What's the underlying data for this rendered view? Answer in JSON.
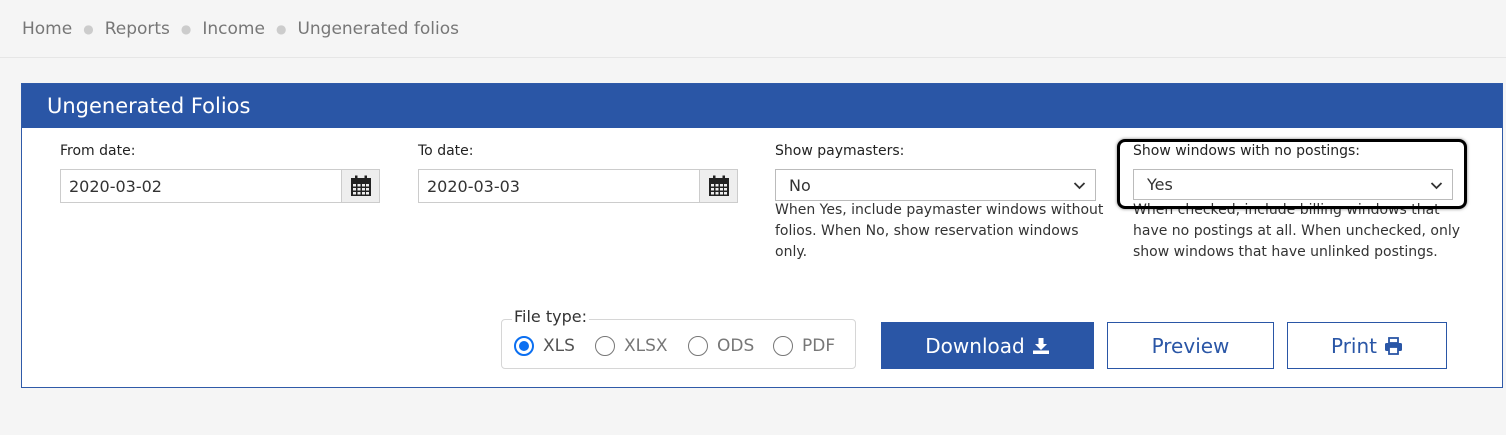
{
  "breadcrumb": [
    "Home",
    "Reports",
    "Income",
    "Ungenerated folios"
  ],
  "panel": {
    "title": "Ungenerated Folios"
  },
  "from_date": {
    "label": "From date:",
    "value": "2020-03-02"
  },
  "to_date": {
    "label": "To date:",
    "value": "2020-03-03"
  },
  "paymasters": {
    "label": "Show paymasters:",
    "selected": "No",
    "help": "When Yes, include paymaster windows without folios. When No, show reservation windows only."
  },
  "no_postings": {
    "label": "Show windows with no postings:",
    "selected": "Yes",
    "help": "When checked, include billing windows that have no postings at all. When unchecked, only show windows that have unlinked postings."
  },
  "file_type": {
    "legend": "File type:",
    "options": [
      "XLS",
      "XLSX",
      "ODS",
      "PDF"
    ],
    "selected": "XLS"
  },
  "buttons": {
    "download": "Download",
    "preview": "Preview",
    "print": "Print"
  },
  "colors": {
    "primary": "#2a56a6",
    "radio_checked": "#0b6ff1"
  },
  "icons": {
    "calendar": "calendar-icon",
    "select": "chevron-down-icon",
    "download": "download-icon",
    "print": "print-icon"
  }
}
